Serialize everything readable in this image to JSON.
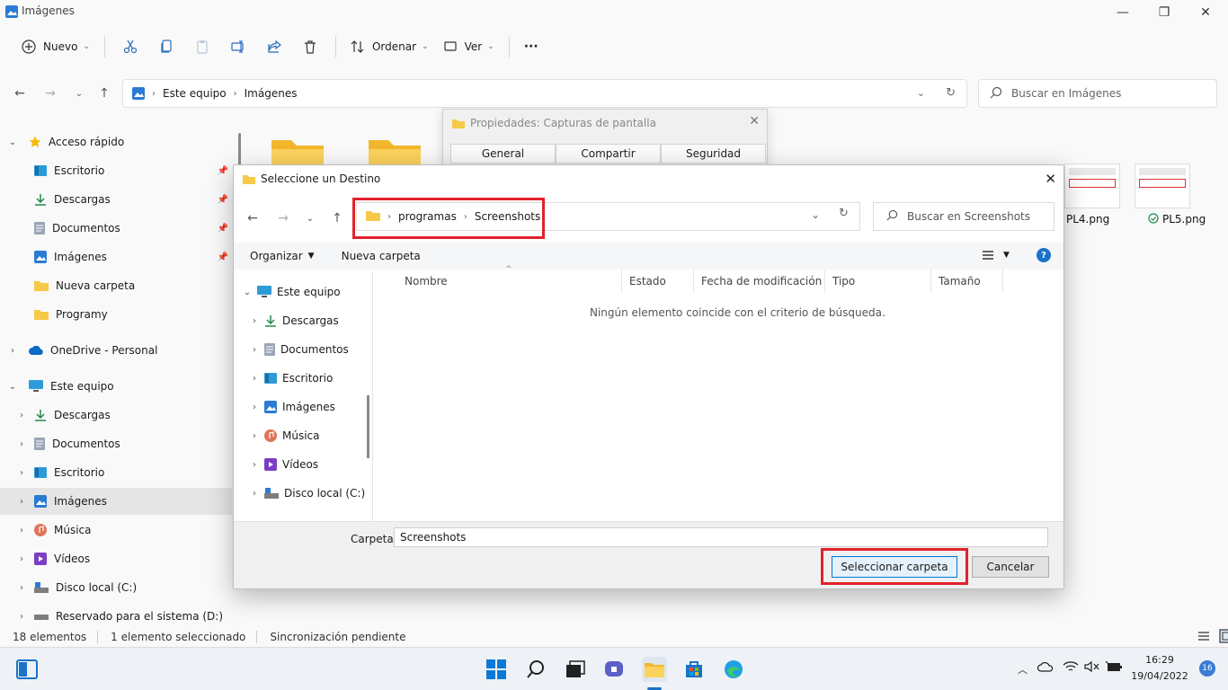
{
  "window": {
    "title": "Imágenes",
    "minimize": "—",
    "maximize": "❐",
    "close": "✕"
  },
  "toolbar": {
    "new_label": "Nuevo",
    "sort_label": "Ordenar",
    "view_label": "Ver",
    "more_label": "···"
  },
  "address": {
    "segments": [
      "Este equipo",
      "Imágenes"
    ]
  },
  "search": {
    "placeholder": "Buscar en Imágenes"
  },
  "sidebar": {
    "quick_access": "Acceso rápido",
    "quick_items": [
      "Escritorio",
      "Descargas",
      "Documentos",
      "Imágenes",
      "Nueva carpeta",
      "Programy"
    ],
    "onedrive": "OneDrive - Personal",
    "this_pc": "Este equipo",
    "pc_items": [
      "Descargas",
      "Documentos",
      "Escritorio",
      "Imágenes",
      "Música",
      "Vídeos",
      "Disco local (C:)",
      "Reservado para el sistema (D:)"
    ]
  },
  "content": {
    "thumbnails": [
      "PL4.png",
      "PL5.png"
    ]
  },
  "status": {
    "count": "18 elementos",
    "selected": "1 elemento seleccionado",
    "sync": "Sincronización pendiente"
  },
  "properties_dialog": {
    "title": "Propiedades: Capturas de pantalla",
    "tabs": [
      "General",
      "Compartir",
      "Seguridad"
    ]
  },
  "dialog": {
    "title": "Seleccione un Destino",
    "path": [
      "programas",
      "Screenshots"
    ],
    "search_placeholder": "Buscar en Screenshots",
    "organize": "Organizar",
    "new_folder": "Nueva carpeta",
    "tree_root": "Este equipo",
    "tree_items": [
      "Descargas",
      "Documentos",
      "Escritorio",
      "Imágenes",
      "Música",
      "Vídeos",
      "Disco local (C:)"
    ],
    "columns": [
      "Nombre",
      "Estado",
      "Fecha de modificación",
      "Tipo",
      "Tamaño"
    ],
    "empty_message": "Ningún elemento coincide con el criterio de búsqueda.",
    "folder_label": "Carpeta:",
    "folder_value": "Screenshots",
    "select_button": "Seleccionar carpeta",
    "cancel_button": "Cancelar",
    "help": "?"
  },
  "taskbar": {
    "time": "16:29",
    "date": "19/04/2022",
    "notifications": "16"
  },
  "colors": {
    "accent": "#0078d4",
    "highlight": "#e2212c",
    "folder": "#f7c948"
  }
}
